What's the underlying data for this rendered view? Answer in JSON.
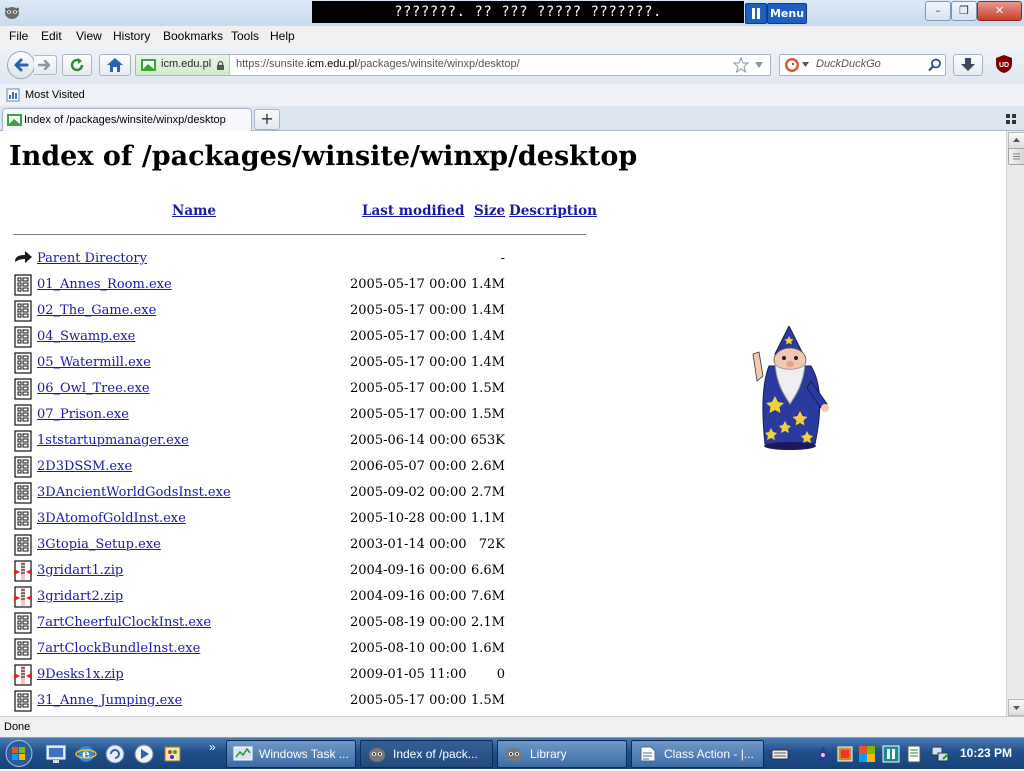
{
  "window": {
    "title": "???????. ?? ??? ????? ???????.",
    "menu_button": "Menu",
    "min_glyph": "–",
    "max_glyph": "❐",
    "close_glyph": "✕"
  },
  "menubar": [
    "File",
    "Edit",
    "View",
    "History",
    "Bookmarks",
    "Tools",
    "Help"
  ],
  "nav": {
    "site_identity": "icm.edu.pl",
    "url_prefix": "https://sunsite.",
    "url_domain": "icm.edu.pl",
    "url_path": "/packages/winsite/winxp/desktop/",
    "search_placeholder": "DuckDuckGo",
    "ublock_label": "UD"
  },
  "bookmarks": {
    "most_visited": "Most Visited"
  },
  "tab": {
    "title": "Index of /packages/winsite/winxp/desktop",
    "new_tab": "+"
  },
  "page": {
    "title": "Index of /packages/winsite/winxp/desktop",
    "columns": {
      "name": "Name",
      "last_modified": "Last modified",
      "size": "Size",
      "description": "Description"
    },
    "parent": {
      "name": "Parent Directory",
      "size": "-"
    },
    "files": [
      {
        "name": "01_Annes_Room.exe",
        "date": "2005-05-17 00:00",
        "size": "1.4M",
        "type": "exe"
      },
      {
        "name": "02_The_Game.exe",
        "date": "2005-05-17 00:00",
        "size": "1.4M",
        "type": "exe"
      },
      {
        "name": "04_Swamp.exe",
        "date": "2005-05-17 00:00",
        "size": "1.4M",
        "type": "exe"
      },
      {
        "name": "05_Watermill.exe",
        "date": "2005-05-17 00:00",
        "size": "1.4M",
        "type": "exe"
      },
      {
        "name": "06_Owl_Tree.exe",
        "date": "2005-05-17 00:00",
        "size": "1.5M",
        "type": "exe"
      },
      {
        "name": "07_Prison.exe",
        "date": "2005-05-17 00:00",
        "size": "1.5M",
        "type": "exe"
      },
      {
        "name": "1ststartupmanager.exe",
        "date": "2005-06-14 00:00",
        "size": "653K",
        "type": "exe"
      },
      {
        "name": "2D3DSSM.exe",
        "date": "2006-05-07 00:00",
        "size": "2.6M",
        "type": "exe"
      },
      {
        "name": "3DAncientWorldGodsInst.exe",
        "date": "2005-09-02 00:00",
        "size": "2.7M",
        "type": "exe"
      },
      {
        "name": "3DAtomofGoldInst.exe",
        "date": "2005-10-28 00:00",
        "size": "1.1M",
        "type": "exe"
      },
      {
        "name": "3Gtopia_Setup.exe",
        "date": "2003-01-14 00:00",
        "size": "72K",
        "type": "exe"
      },
      {
        "name": "3gridart1.zip",
        "date": "2004-09-16 00:00",
        "size": "6.6M",
        "type": "zip"
      },
      {
        "name": "3gridart2.zip",
        "date": "2004-09-16 00:00",
        "size": "7.6M",
        "type": "zip"
      },
      {
        "name": "7artCheerfulClockInst.exe",
        "date": "2005-08-19 00:00",
        "size": "2.1M",
        "type": "exe"
      },
      {
        "name": "7artClockBundleInst.exe",
        "date": "2005-08-10 00:00",
        "size": "1.6M",
        "type": "exe"
      },
      {
        "name": "9Desks1x.zip",
        "date": "2009-01-05 11:00",
        "size": "0",
        "type": "zip"
      },
      {
        "name": "31_Anne_Jumping.exe",
        "date": "2005-05-17 00:00",
        "size": "1.5M",
        "type": "exe"
      }
    ]
  },
  "status": {
    "text": "Done"
  },
  "taskbar": {
    "quicklaunch_more": "»",
    "tasks": [
      {
        "label": "Windows Task ..."
      },
      {
        "label": "Index of /pack..."
      },
      {
        "label": "Library"
      },
      {
        "label": "Class Action - |..."
      }
    ],
    "clock": "10:23 PM"
  }
}
